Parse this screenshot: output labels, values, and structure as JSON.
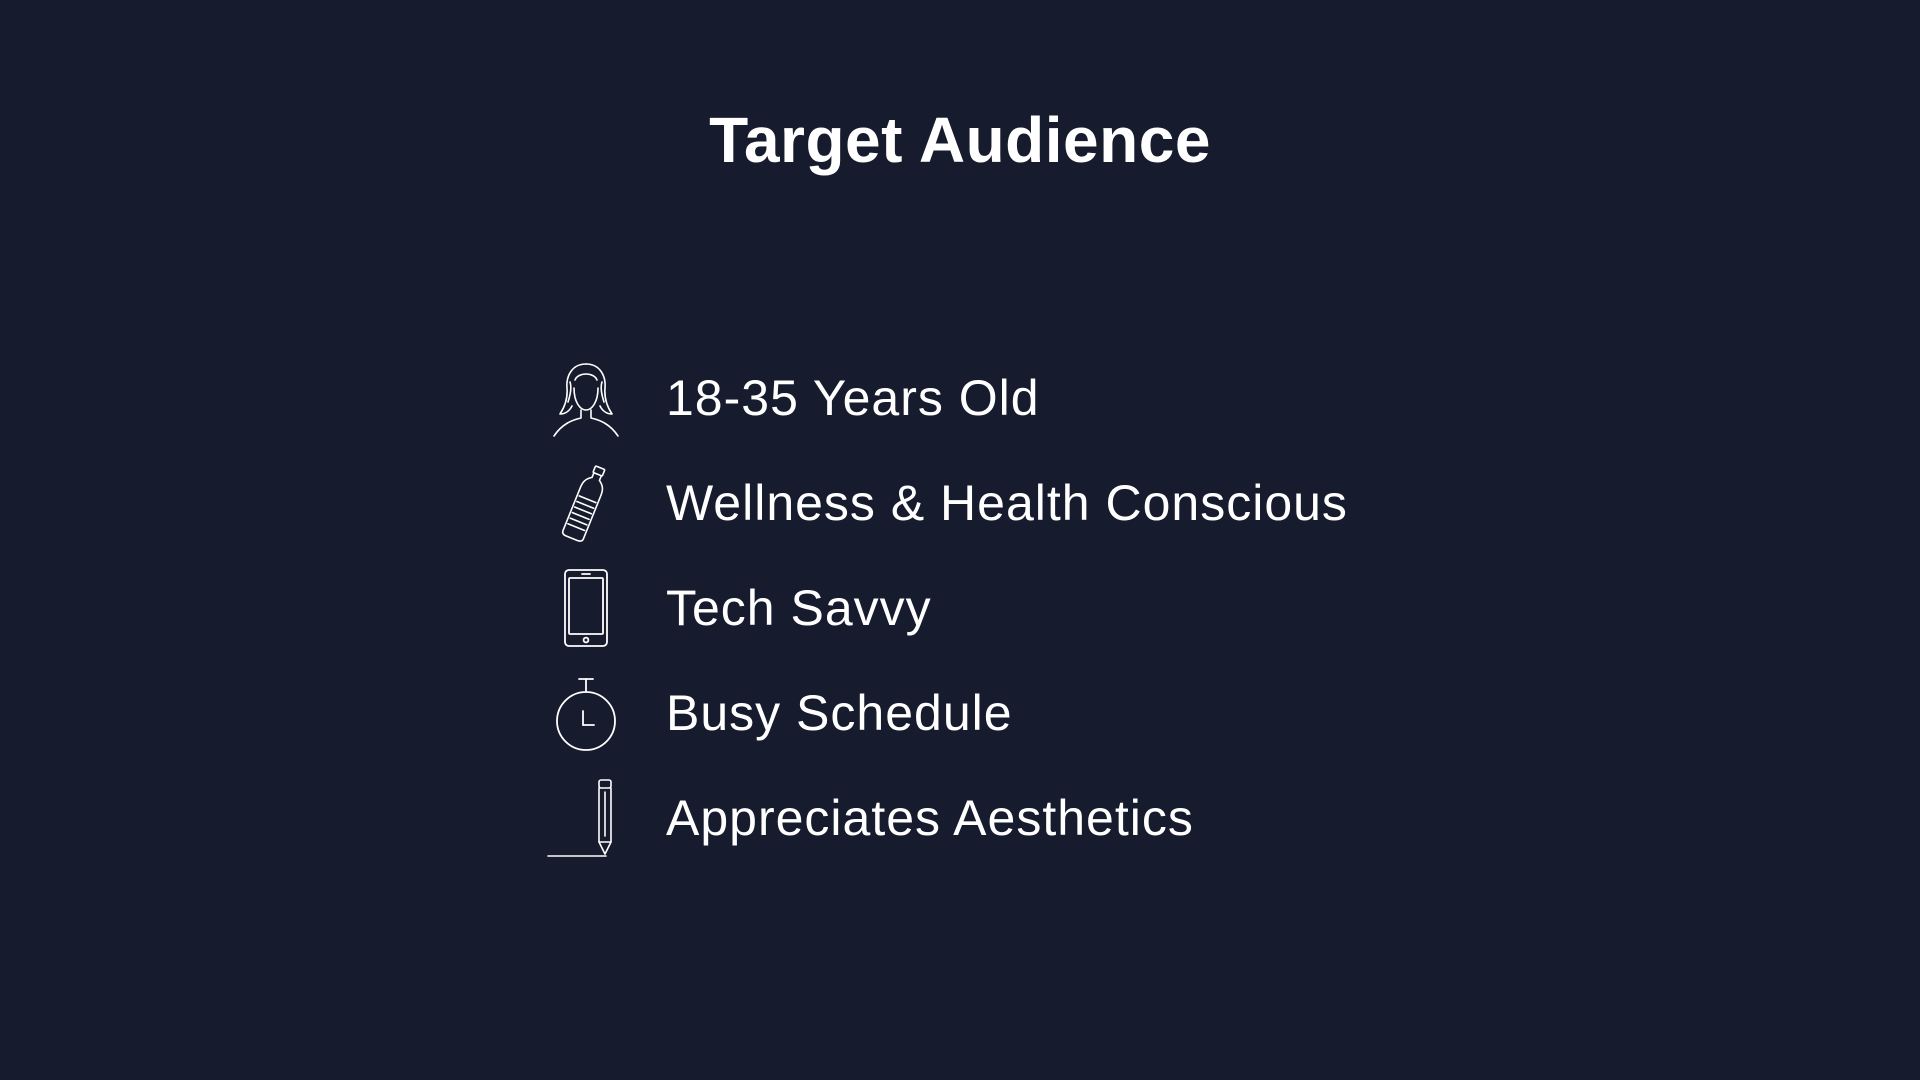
{
  "slide": {
    "title": "Target Audience",
    "background_color": "#171b2e",
    "text_color": "#ffffff",
    "items": [
      {
        "label": "18-35 Years Old",
        "icon": "person-head-icon"
      },
      {
        "label": "Wellness & Health Conscious",
        "icon": "water-bottle-icon"
      },
      {
        "label": "Tech Savvy",
        "icon": "smartphone-icon"
      },
      {
        "label": "Busy Schedule",
        "icon": "stopwatch-icon"
      },
      {
        "label": "Appreciates Aesthetics",
        "icon": "pen-icon"
      }
    ]
  }
}
